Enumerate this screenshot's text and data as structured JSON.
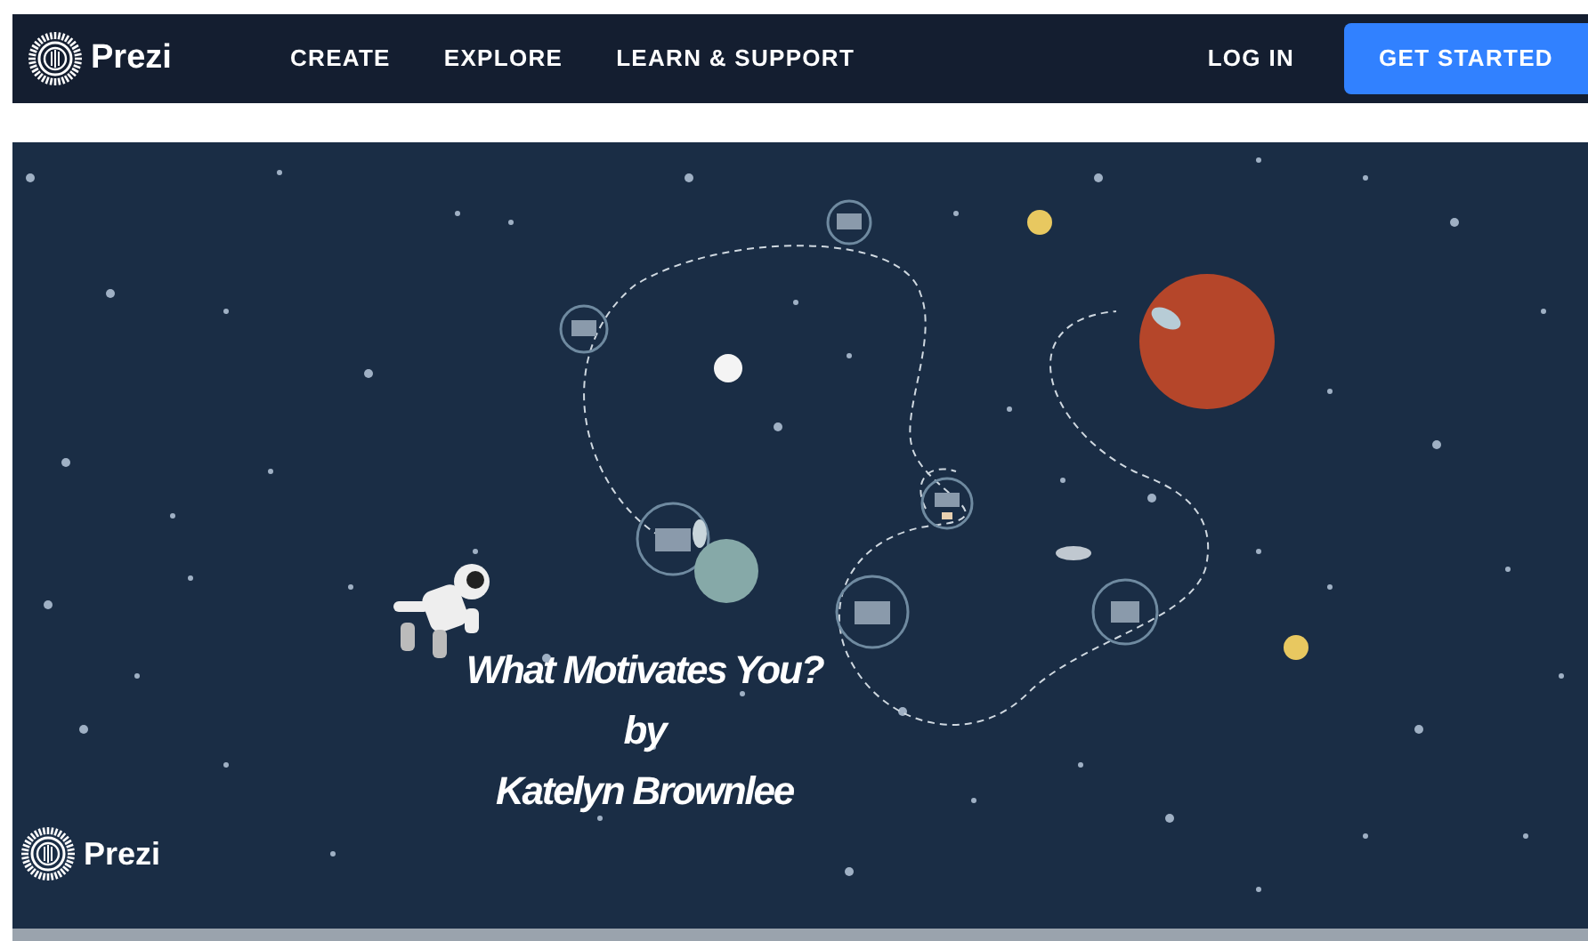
{
  "nav": {
    "logo": "Prezi",
    "links": [
      "CREATE",
      "EXPLORE",
      "LEARN & SUPPORT"
    ],
    "login": "LOG IN",
    "cta": "GET STARTED"
  },
  "slide": {
    "title_lines": [
      "What Motivates You?",
      "by",
      "Katelyn Brownlee"
    ],
    "watermark": "Prezi"
  }
}
